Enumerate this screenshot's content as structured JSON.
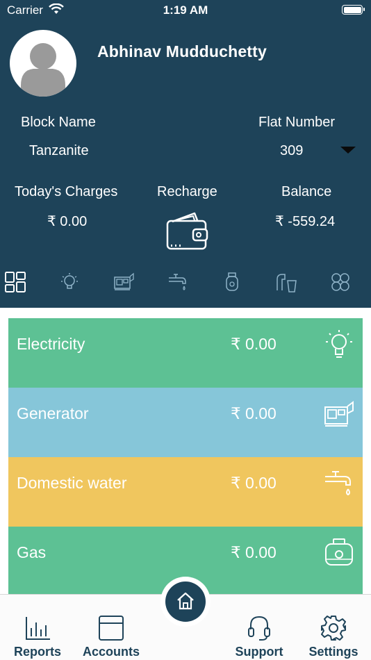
{
  "status_bar": {
    "carrier": "Carrier",
    "time": "1:19 AM"
  },
  "profile": {
    "name": "Abhinav Mudduchetty"
  },
  "block": {
    "label": "Block Name",
    "value": "Tanzanite"
  },
  "flat": {
    "label": "Flat Number",
    "value": "309"
  },
  "charges": {
    "label": "Today's Charges",
    "value": "₹ 0.00"
  },
  "recharge": {
    "label": "Recharge"
  },
  "balance": {
    "label": "Balance",
    "value": "₹ -559.24"
  },
  "category_icons": [
    "grid-icon",
    "bulb-icon",
    "generator-icon",
    "tap-icon",
    "gas-cylinder-icon",
    "water-tap-glass-icon",
    "settings-cluster-icon"
  ],
  "cards": [
    {
      "name": "Electricity",
      "amount": "₹ 0.00",
      "icon": "bulb-icon",
      "color": "#5dc194"
    },
    {
      "name": "Generator",
      "amount": "₹ 0.00",
      "icon": "generator-icon",
      "color": "#86c6d9"
    },
    {
      "name": "Domestic water",
      "amount": "₹ 0.00",
      "icon": "tap-icon",
      "color": "#f0c65e"
    },
    {
      "name": "Gas",
      "amount": "₹ 0.00",
      "icon": "gas-cylinder-icon",
      "color": "#5dc194"
    }
  ],
  "tabbar": {
    "reports": "Reports",
    "accounts": "Accounts",
    "support": "Support",
    "settings": "Settings"
  },
  "colors": {
    "header": "#1e4359",
    "tab_text": "#1e4359"
  }
}
